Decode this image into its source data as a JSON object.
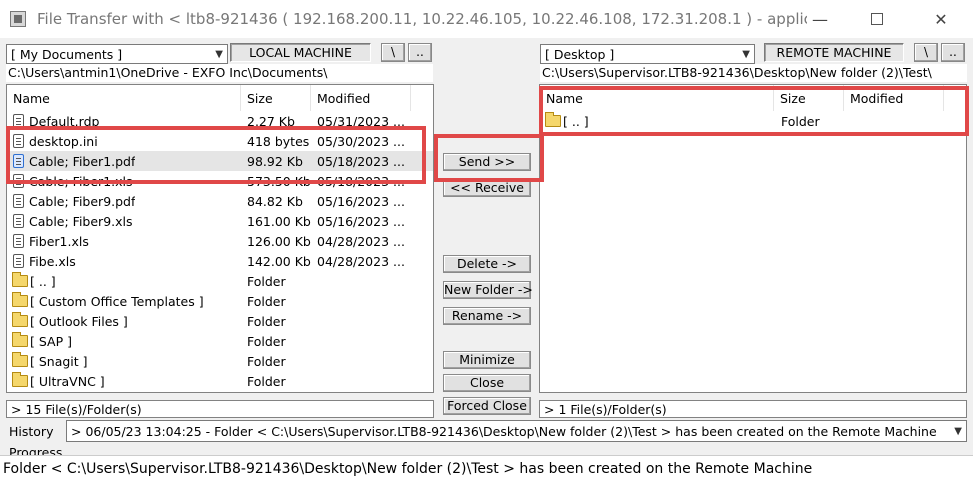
{
  "window": {
    "title": "File Transfer with < ltb8-921436 ( 192.168.200.11, 10.22.46.105, 10.22.46.108, 172.31.208.1 ) - application mode > ...",
    "minimize_glyph": "—",
    "close_glyph": "✕"
  },
  "local": {
    "folder": "[ My Documents ]",
    "machine_label": "LOCAL MACHINE",
    "root_button": "\\",
    "up_button": "..",
    "path": "C:\\Users\\antmin1\\OneDrive - EXFO Inc\\Documents\\",
    "columns": [
      "Name",
      "Size",
      "Modified"
    ],
    "files": [
      {
        "name": "Default.rdp",
        "size": "2.27 Kb",
        "modified": "05/31/2023 ..."
      },
      {
        "name": "desktop.ini",
        "size": "418 bytes",
        "modified": "05/30/2023 ..."
      },
      {
        "name": "Cable; Fiber1.pdf",
        "size": "98.92 Kb",
        "modified": "05/18/2023 ..."
      },
      {
        "name": "Cable; Fiber1.xls",
        "size": "573.50 Kb",
        "modified": "05/18/2023 ..."
      },
      {
        "name": "Cable; Fiber9.pdf",
        "size": "84.82 Kb",
        "modified": "05/16/2023 ..."
      },
      {
        "name": "Cable; Fiber9.xls",
        "size": "161.00 Kb",
        "modified": "05/16/2023 ..."
      },
      {
        "name": "Fiber1.xls",
        "size": "126.00 Kb",
        "modified": "04/28/2023 ..."
      },
      {
        "name": "Fibe.xls",
        "size": "142.00 Kb",
        "modified": "04/28/2023 ..."
      }
    ],
    "folders": [
      {
        "name": "[ .. ]",
        "size": "Folder"
      },
      {
        "name": "[ Custom Office Templates ]",
        "size": "Folder"
      },
      {
        "name": "[ Outlook Files ]",
        "size": "Folder"
      },
      {
        "name": "[ SAP ]",
        "size": "Folder"
      },
      {
        "name": "[ Snagit ]",
        "size": "Folder"
      },
      {
        "name": "[ UltraVNC ]",
        "size": "Folder"
      }
    ],
    "status": "> 15 File(s)/Folder(s)"
  },
  "remote": {
    "folder": "[ Desktop ]",
    "machine_label": "REMOTE MACHINE",
    "root_button": "\\",
    "up_button": "..",
    "path": "C:\\Users\\Supervisor.LTB8-921436\\Desktop\\New folder (2)\\Test\\",
    "columns": [
      "Name",
      "Size",
      "Modified"
    ],
    "folders": [
      {
        "name": "[ .. ]",
        "size": "Folder"
      }
    ],
    "status": "> 1 File(s)/Folder(s)"
  },
  "actions": {
    "send": "Send >>",
    "receive": "<< Receive",
    "delete": "Delete ->",
    "new_folder": "New Folder ->",
    "rename": "Rename ->",
    "minimize": "Minimize",
    "close": "Close",
    "forced_close": "Forced Close"
  },
  "history": {
    "label": "History",
    "value": "> 06/05/23 13:04:25 - Folder < C:\\Users\\Supervisor.LTB8-921436\\Desktop\\New folder (2)\\Test > has been created on the Remote Machine",
    "progress_label": "Progress"
  },
  "status_bar": "Folder < C:\\Users\\Supervisor.LTB8-921436\\Desktop\\New folder (2)\\Test > has been created on the Remote Machine",
  "colors": {
    "highlight": "#e04848",
    "folder": "#f5d76b"
  }
}
